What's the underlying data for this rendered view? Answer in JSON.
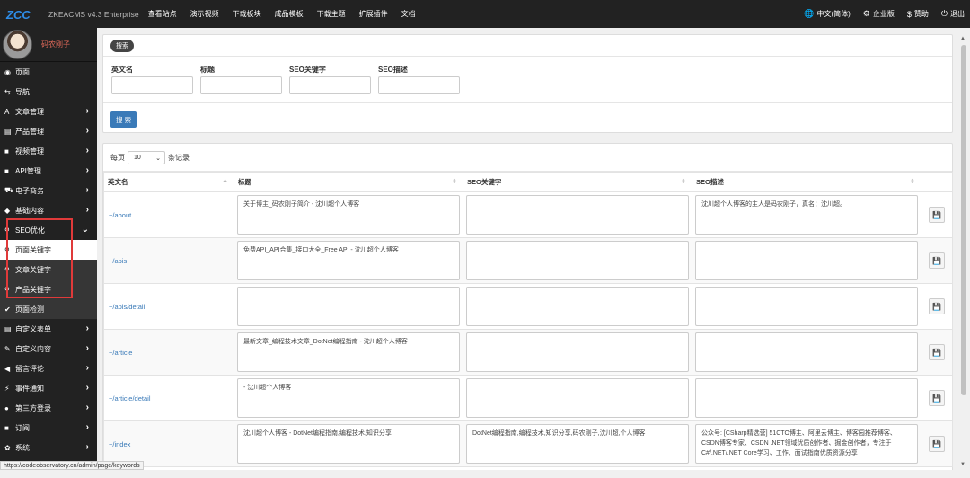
{
  "top": {
    "brand": "ZKEACMS v4.3 Enterprise",
    "nav": [
      "查看站点",
      "演示视频",
      "下载板块",
      "成品模板",
      "下载主题",
      "扩展插件",
      "文档"
    ],
    "right": [
      {
        "icon": "globe-icon",
        "label": "中文(简体)",
        "glyph": "🌐"
      },
      {
        "icon": "gear-icon",
        "label": "企业版",
        "glyph": "⚙"
      },
      {
        "icon": "dollar-icon",
        "label": "赞助",
        "glyph": "$"
      },
      {
        "icon": "power-icon",
        "label": "退出",
        "glyph": "⏻"
      }
    ]
  },
  "sidebar": {
    "user": "码农刚子",
    "items": [
      {
        "icon": "eye-icon",
        "glyph": "◉",
        "label": "页面",
        "arrow": ""
      },
      {
        "icon": "nav-icon",
        "glyph": "⇆",
        "label": "导航",
        "arrow": ""
      },
      {
        "icon": "font-icon",
        "glyph": "A",
        "label": "文章管理",
        "arrow": "›"
      },
      {
        "icon": "list-icon",
        "glyph": "▤",
        "label": "产品管理",
        "arrow": "›"
      },
      {
        "icon": "video-icon",
        "glyph": "■",
        "label": "视频管理",
        "arrow": "›"
      },
      {
        "icon": "api-icon",
        "glyph": "■",
        "label": "API管理",
        "arrow": "›"
      },
      {
        "icon": "cart-icon",
        "glyph": "⛟",
        "label": "电子商务",
        "arrow": "›"
      },
      {
        "icon": "pin-icon",
        "glyph": "◆",
        "label": "基础内容",
        "arrow": "›"
      },
      {
        "icon": "search-icon",
        "glyph": "⚲",
        "label": "SEO优化",
        "arrow": "⌄"
      }
    ],
    "subitems": [
      {
        "icon": "search-icon",
        "glyph": "⚲",
        "label": "页面关键字",
        "active": true
      },
      {
        "icon": "search-icon",
        "glyph": "⚲",
        "label": "文章关键字",
        "active": false
      },
      {
        "icon": "search-icon",
        "glyph": "⚲",
        "label": "产品关键字",
        "active": false
      },
      {
        "icon": "check-icon",
        "glyph": "✔",
        "label": "页面检测",
        "active": false
      }
    ],
    "items2": [
      {
        "icon": "form-icon",
        "glyph": "▤",
        "label": "自定义表单",
        "arrow": "›"
      },
      {
        "icon": "edit-icon",
        "glyph": "✎",
        "label": "自定义内容",
        "arrow": "›"
      },
      {
        "icon": "comment-icon",
        "glyph": "◀",
        "label": "留言评论",
        "arrow": "›"
      },
      {
        "icon": "bolt-icon",
        "glyph": "⚡",
        "label": "事件通知",
        "arrow": "›"
      },
      {
        "icon": "user-icon",
        "glyph": "●",
        "label": "第三方登录",
        "arrow": "›"
      },
      {
        "icon": "rss-icon",
        "glyph": "■",
        "label": "订阅",
        "arrow": "›"
      },
      {
        "icon": "settings-icon",
        "glyph": "✿",
        "label": "系统",
        "arrow": "›"
      }
    ]
  },
  "search": {
    "badge": "搜索",
    "fields": [
      "英文名",
      "标题",
      "SEO关键字",
      "SEO描述"
    ],
    "button": "搜 索"
  },
  "table": {
    "per_page_prefix": "每页",
    "per_page_value": "10",
    "per_page_suffix": "条记录",
    "columns": [
      "英文名",
      "标题",
      "SEO关键字",
      "SEO描述"
    ],
    "rows": [
      {
        "url": "~/about",
        "title": "关于博主_码农刚子简介 - 沈川超个人博客",
        "keywords": "",
        "desc": "沈川超个人博客的主人是码农刚子，真名：沈川超。"
      },
      {
        "url": "~/apis",
        "title": "免费API_API合集_接口大全_Free API - 沈川超个人博客",
        "keywords": "",
        "desc": ""
      },
      {
        "url": "~/apis/detail",
        "title": "",
        "keywords": "",
        "desc": ""
      },
      {
        "url": "~/article",
        "title": "最新文章_编程技术文章_DotNet编程指南 - 沈川超个人博客",
        "keywords": "",
        "desc": ""
      },
      {
        "url": "~/article/detail",
        "title": " - 沈川超个人博客",
        "keywords": "",
        "desc": ""
      },
      {
        "url": "~/index",
        "title": "沈川超个人博客 - DotNet编程指南,编程技术,知识分享",
        "keywords": "DotNet编程指南,编程技术,知识分享,码农刚子,沈川超,个人博客",
        "desc": "公众号: [CSharp精选营] 51CTO博主、阿里云博主、博客园推荐博客、CSDN博客专家、CSDN .NET领域优质创作者、掘金创作者，专注于C#/.NET/.NET Core学习、工作、面试指南优质资源分享"
      }
    ]
  },
  "status": "https://codeobservatory.cn/admin/page/keywords"
}
